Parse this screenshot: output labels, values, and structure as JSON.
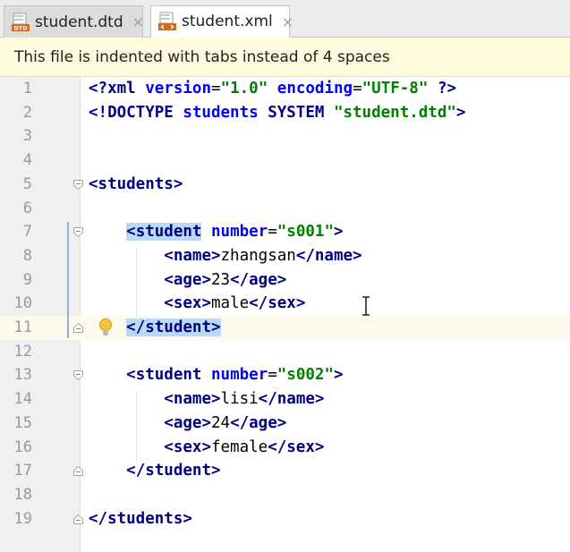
{
  "tabs": [
    {
      "label": "student.dtd",
      "icon_text": "DTD",
      "active": false
    },
    {
      "label": "student.xml",
      "active": true
    }
  ],
  "tab_close": "×",
  "banner": {
    "message": "This file is indented with tabs instead of 4 spaces"
  },
  "colors": {
    "tag": "#000080",
    "attr": "#0000ff",
    "value": "#008000",
    "highlight": "#b9d9f5",
    "banner_bg": "#fffbdd"
  },
  "lines": [
    {
      "n": "1",
      "tokens": [
        {
          "c": "pi",
          "t": "<?"
        },
        {
          "c": "pi",
          "t": "xml "
        },
        {
          "c": "attr",
          "t": "version"
        },
        {
          "c": "txt",
          "t": "="
        },
        {
          "c": "val",
          "t": "\"1.0\""
        },
        {
          "c": "txt",
          "t": " "
        },
        {
          "c": "attr",
          "t": "encoding"
        },
        {
          "c": "txt",
          "t": "="
        },
        {
          "c": "val",
          "t": "\"UTF-8\""
        },
        {
          "c": "txt",
          "t": " "
        },
        {
          "c": "pi",
          "t": "?>"
        }
      ]
    },
    {
      "n": "2",
      "tokens": [
        {
          "c": "tag",
          "t": "<!DOCTYPE "
        },
        {
          "c": "attr",
          "t": "students"
        },
        {
          "c": "tag",
          "t": " SYSTEM "
        },
        {
          "c": "val",
          "t": "\"student.dtd\""
        },
        {
          "c": "tag",
          "t": ">"
        }
      ]
    },
    {
      "n": "3",
      "tokens": []
    },
    {
      "n": "4",
      "tokens": []
    },
    {
      "n": "5",
      "tokens": [
        {
          "c": "tag",
          "t": "<students>"
        }
      ]
    },
    {
      "n": "6",
      "tokens": []
    },
    {
      "n": "7",
      "tokens": [
        {
          "c": "txt",
          "t": "    "
        },
        {
          "c": "tag hl",
          "t": "<student"
        },
        {
          "c": "txt",
          "t": " "
        },
        {
          "c": "attr",
          "t": "number"
        },
        {
          "c": "txt",
          "t": "="
        },
        {
          "c": "val",
          "t": "\"s001\""
        },
        {
          "c": "tag",
          "t": ">"
        }
      ]
    },
    {
      "n": "8",
      "tokens": [
        {
          "c": "txt",
          "t": "        "
        },
        {
          "c": "tag",
          "t": "<name>"
        },
        {
          "c": "txt",
          "t": "zhangsan"
        },
        {
          "c": "tag",
          "t": "</name>"
        }
      ]
    },
    {
      "n": "9",
      "tokens": [
        {
          "c": "txt",
          "t": "        "
        },
        {
          "c": "tag",
          "t": "<age>"
        },
        {
          "c": "txt",
          "t": "23"
        },
        {
          "c": "tag",
          "t": "</age>"
        }
      ]
    },
    {
      "n": "10",
      "tokens": [
        {
          "c": "txt",
          "t": "        "
        },
        {
          "c": "tag",
          "t": "<sex>"
        },
        {
          "c": "txt",
          "t": "male"
        },
        {
          "c": "tag",
          "t": "</sex>"
        }
      ]
    },
    {
      "n": "11",
      "current": true,
      "tokens": [
        {
          "c": "txt",
          "t": "    "
        },
        {
          "c": "tag hl",
          "t": "</student>"
        }
      ]
    },
    {
      "n": "12",
      "tokens": []
    },
    {
      "n": "13",
      "tokens": [
        {
          "c": "txt",
          "t": "    "
        },
        {
          "c": "tag",
          "t": "<student"
        },
        {
          "c": "txt",
          "t": " "
        },
        {
          "c": "attr",
          "t": "number"
        },
        {
          "c": "txt",
          "t": "="
        },
        {
          "c": "val",
          "t": "\"s002\""
        },
        {
          "c": "tag",
          "t": ">"
        }
      ]
    },
    {
      "n": "14",
      "tokens": [
        {
          "c": "txt",
          "t": "        "
        },
        {
          "c": "tag",
          "t": "<name>"
        },
        {
          "c": "txt",
          "t": "lisi"
        },
        {
          "c": "tag",
          "t": "</name>"
        }
      ]
    },
    {
      "n": "15",
      "tokens": [
        {
          "c": "txt",
          "t": "        "
        },
        {
          "c": "tag",
          "t": "<age>"
        },
        {
          "c": "txt",
          "t": "24"
        },
        {
          "c": "tag",
          "t": "</age>"
        }
      ]
    },
    {
      "n": "16",
      "tokens": [
        {
          "c": "txt",
          "t": "        "
        },
        {
          "c": "tag",
          "t": "<sex>"
        },
        {
          "c": "txt",
          "t": "female"
        },
        {
          "c": "tag",
          "t": "</sex>"
        }
      ]
    },
    {
      "n": "17",
      "tokens": [
        {
          "c": "txt",
          "t": "    "
        },
        {
          "c": "tag",
          "t": "</student>"
        }
      ]
    },
    {
      "n": "18",
      "tokens": []
    },
    {
      "n": "19",
      "tokens": [
        {
          "c": "tag",
          "t": "</students>"
        }
      ]
    }
  ],
  "fold_markers": [
    {
      "line": 5,
      "kind": "open"
    },
    {
      "line": 7,
      "kind": "open"
    },
    {
      "line": 11,
      "kind": "close"
    },
    {
      "line": 13,
      "kind": "open"
    },
    {
      "line": 17,
      "kind": "close"
    },
    {
      "line": 19,
      "kind": "close"
    }
  ],
  "icons": {
    "intention": "lightbulb-icon",
    "cursor": "text-cursor-icon",
    "dtd_file": "dtd-file-icon",
    "xml_file": "xml-file-icon"
  }
}
